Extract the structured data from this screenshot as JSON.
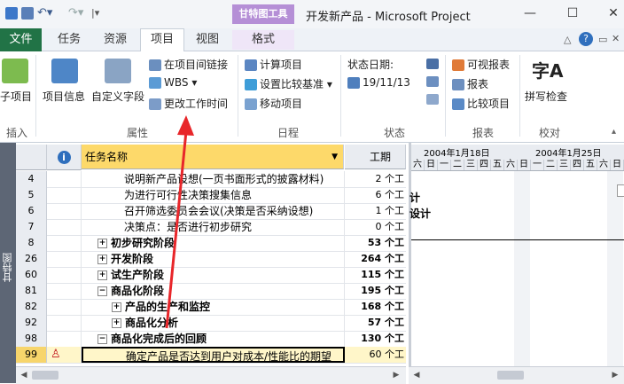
{
  "title_bar": {
    "context_tab_title": "甘特图工具",
    "window_title": "开发新产品  -  Microsoft Project",
    "minimize": "—",
    "maximize": "☐",
    "close": "✕"
  },
  "tabs": {
    "file": "文件",
    "items": [
      "任务",
      "资源",
      "项目",
      "视图",
      "格式"
    ],
    "active": "项目"
  },
  "ribbon": {
    "groups": {
      "insert": "插入",
      "properties": "属性",
      "schedule": "日程",
      "status": "状态",
      "reports": "报表",
      "proofing": "校对"
    },
    "subproject": "子项目",
    "project_info": "项目信息",
    "custom_fields": "自定义字段",
    "links_between_projects": "在项目间链接",
    "wbs": "WBS",
    "change_working_time": "更改工作时间",
    "calculate_project": "计算项目",
    "set_baseline": "设置比较基准",
    "move_project": "移动项目",
    "status_date_label": "状态日期:",
    "status_date": "19/11/13",
    "visual_reports": "可视报表",
    "reports": "报表",
    "compare_projects": "比较项目",
    "spelling": "拼写检查"
  },
  "view_bar": {
    "label": "甘特图"
  },
  "grid": {
    "headers": {
      "indicator": "ⓘ",
      "task_name": "任务名称",
      "duration": "工期"
    },
    "rows": [
      {
        "id": "4",
        "name": "说明新产品设想(一页书面形式的披露材料)",
        "duration": "2 个工",
        "level": 3,
        "bold": false,
        "toggle": ""
      },
      {
        "id": "5",
        "name": "为进行可行性决策搜集信息",
        "duration": "6 个工",
        "level": 3,
        "bold": false,
        "toggle": ""
      },
      {
        "id": "6",
        "name": "召开筛选委员会会议(决策是否采纳设想)",
        "duration": "1 个工",
        "level": 3,
        "bold": false,
        "toggle": ""
      },
      {
        "id": "7",
        "name": "决策点：是否进行初步研究",
        "duration": "0 个工",
        "level": 3,
        "bold": false,
        "toggle": ""
      },
      {
        "id": "8",
        "name": "初步研究阶段",
        "duration": "53 个工",
        "level": 1,
        "bold": true,
        "toggle": "+"
      },
      {
        "id": "26",
        "name": "开发阶段",
        "duration": "264 个工",
        "level": 1,
        "bold": true,
        "toggle": "+"
      },
      {
        "id": "60",
        "name": "试生产阶段",
        "duration": "115 个工",
        "level": 1,
        "bold": true,
        "toggle": "+"
      },
      {
        "id": "81",
        "name": "商品化阶段",
        "duration": "195 个工",
        "level": 1,
        "bold": true,
        "toggle": "−"
      },
      {
        "id": "82",
        "name": "产品的生产和监控",
        "duration": "168 个工",
        "level": 2,
        "bold": true,
        "toggle": "+"
      },
      {
        "id": "92",
        "name": "商品化分析",
        "duration": "57 个工",
        "level": 2,
        "bold": true,
        "toggle": "+"
      },
      {
        "id": "98",
        "name": "商品化完成后的回顾",
        "duration": "130 个工",
        "level": 1,
        "bold": true,
        "toggle": "−"
      },
      {
        "id": "99",
        "name": "确定产品是否达到用户对成本/性能比的期望",
        "duration": "60 个工",
        "level": 3,
        "bold": false,
        "toggle": ""
      }
    ]
  },
  "gantt": {
    "weeks": [
      "2004年1月18日",
      "2004年1月25日"
    ],
    "days": [
      "六",
      "日",
      "一",
      "二",
      "三",
      "四",
      "五",
      "六",
      "日",
      "一",
      "二",
      "三",
      "四",
      "五",
      "六",
      "日"
    ],
    "labels": [
      "计",
      "设计"
    ]
  },
  "colors": {
    "file_tab": "#217346",
    "context_tab": "#b58fd6",
    "selected_row": "#fff6c9",
    "task_name_header": "#fdd96a",
    "arrow": "#e8262a"
  }
}
